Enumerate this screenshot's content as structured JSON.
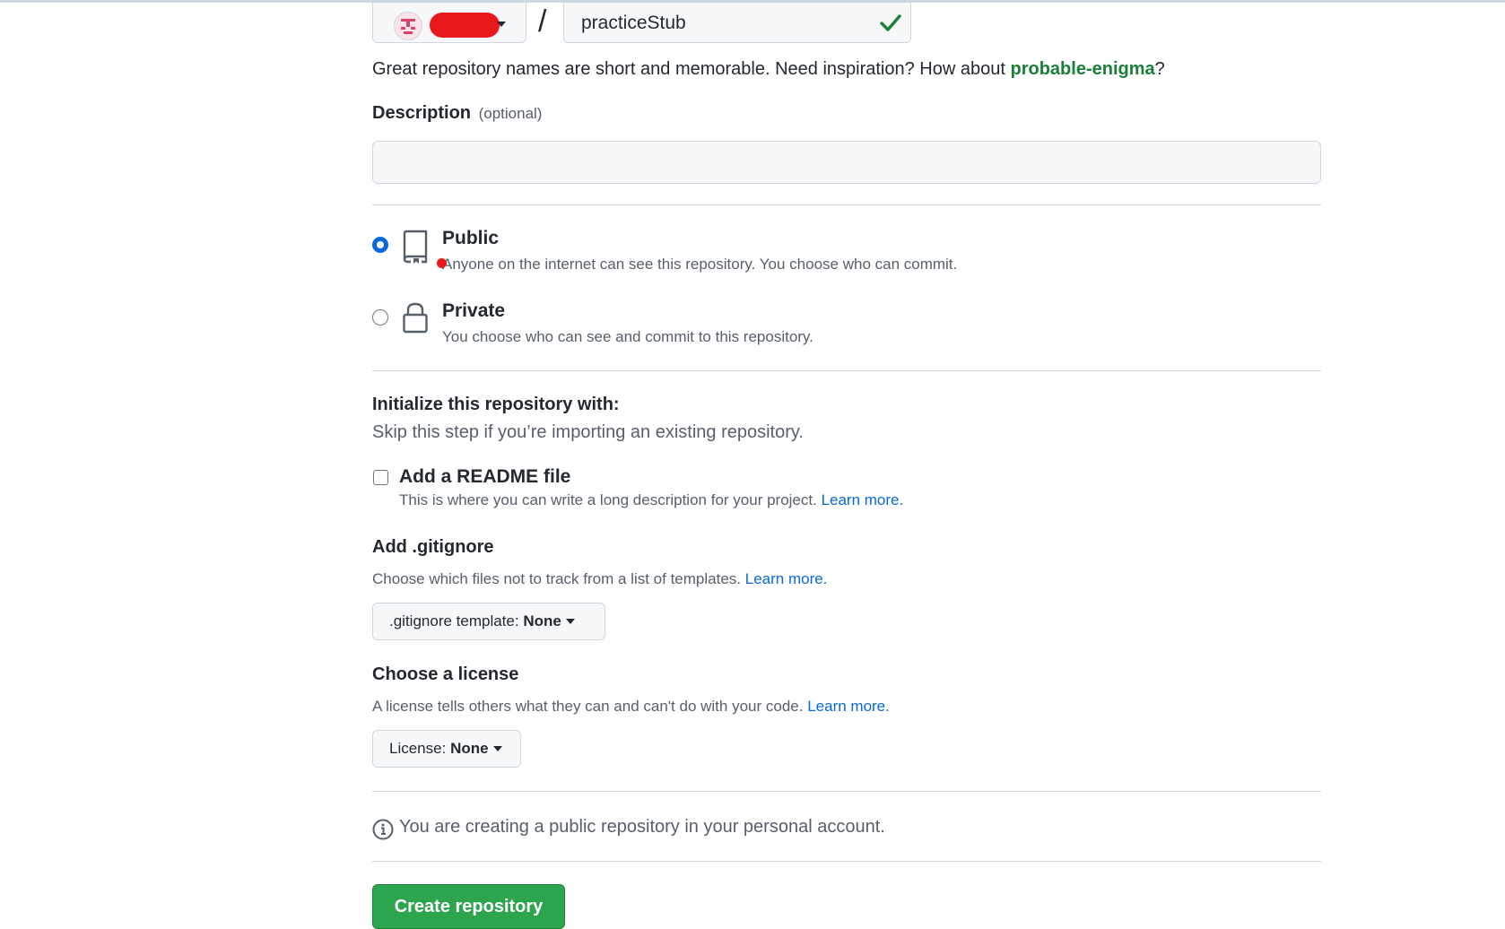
{
  "owner": {
    "avatar_icon": "identicon-avatar",
    "name_redacted": true
  },
  "repo": {
    "separator": "/",
    "name": "practiceStub",
    "valid_icon": "check-icon"
  },
  "name_hint": {
    "prefix": "Great repository names are short and memorable. Need inspiration? How about ",
    "suggestion": "probable-enigma",
    "suffix": "?"
  },
  "description": {
    "label": "Description",
    "optional": "(optional)",
    "value": ""
  },
  "visibility": {
    "public": {
      "title": "Public",
      "desc": "Anyone on the internet can see this repository. You choose who can commit.",
      "checked": true,
      "icon": "repo-icon"
    },
    "private": {
      "title": "Private",
      "desc": "You choose who can see and commit to this repository.",
      "checked": false,
      "icon": "lock-icon"
    }
  },
  "init": {
    "title": "Initialize this repository with:",
    "subtitle": "Skip this step if you’re importing an existing repository.",
    "readme": {
      "label": "Add a README file",
      "desc": "This is where you can write a long description for your project.",
      "link": "Learn more.",
      "checked": false
    }
  },
  "gitignore": {
    "title": "Add .gitignore",
    "desc": "Choose which files not to track from a list of templates.",
    "link": "Learn more.",
    "button_prefix": ".gitignore template:",
    "button_value": "None"
  },
  "license": {
    "title": "Choose a license",
    "desc": "A license tells others what they can and can't do with your code.",
    "link": "Learn more.",
    "button_prefix": "License:",
    "button_value": "None"
  },
  "notice": {
    "icon": "info-icon",
    "text": "You are creating a public repository in your personal account."
  },
  "submit": {
    "label": "Create repository"
  },
  "colors": {
    "accent_blue": "#0969da",
    "success_green": "#2da44e",
    "suggestion_green": "#1a7f37",
    "redaction_red": "#e8191b"
  }
}
